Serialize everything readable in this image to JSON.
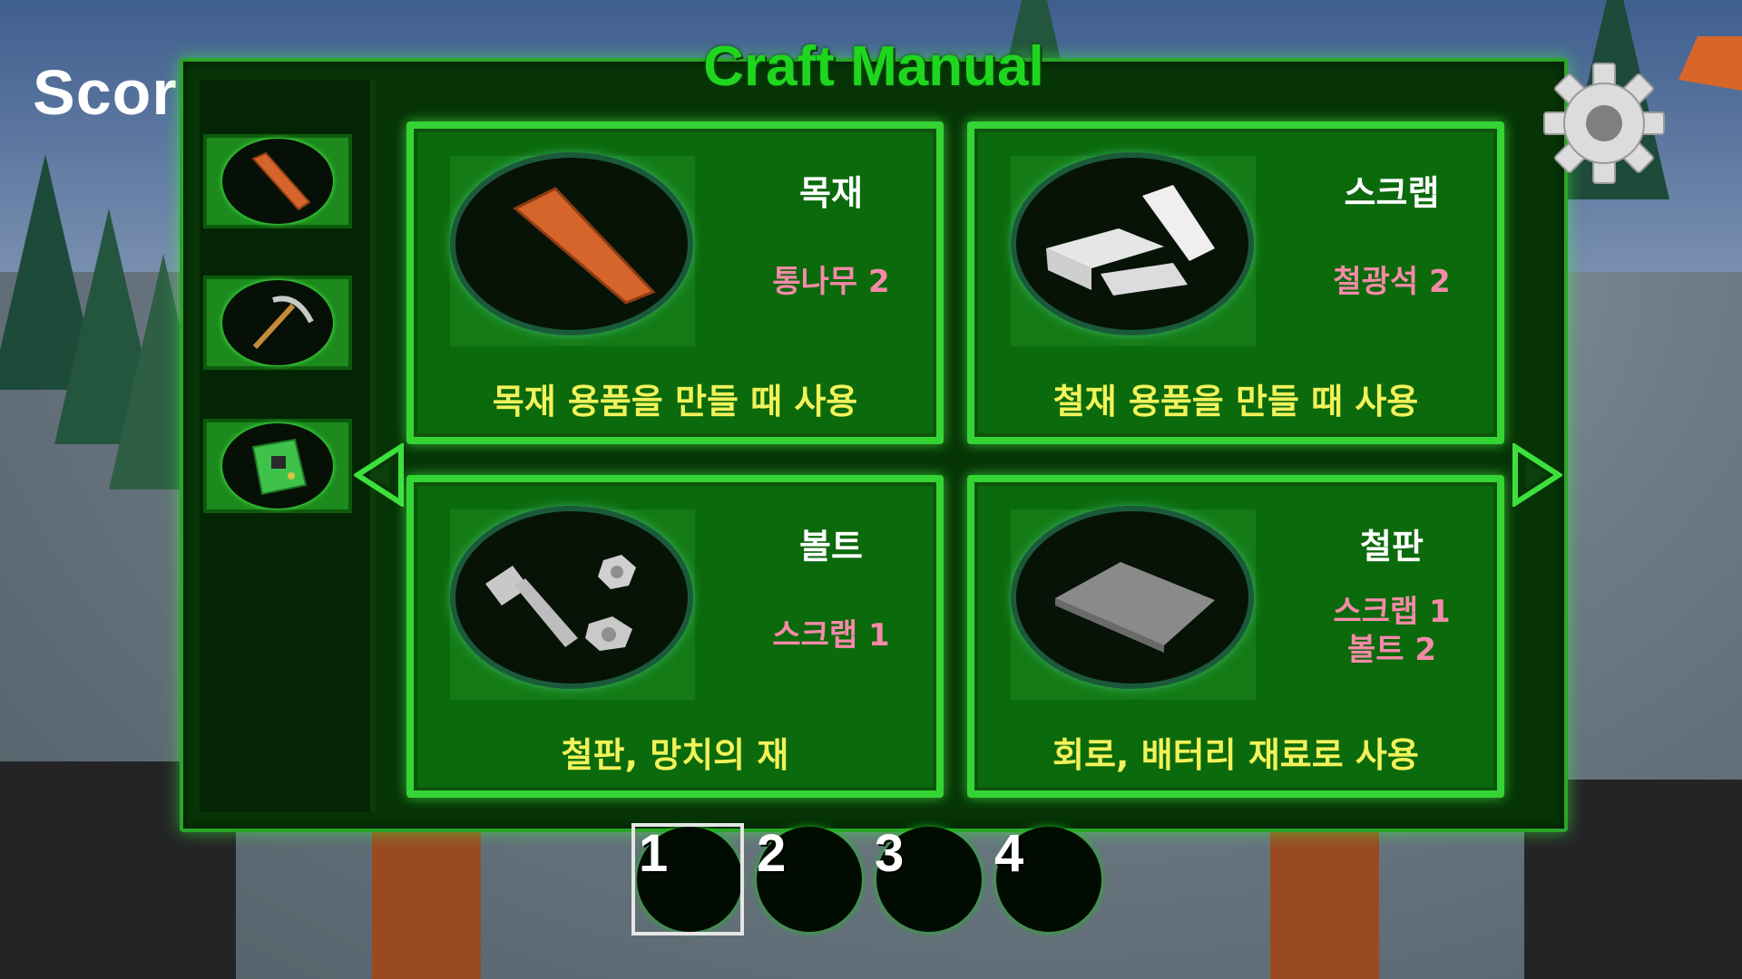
{
  "hud": {
    "score_label": "Scor"
  },
  "manual": {
    "title": "Craft Manual",
    "categories": [
      {
        "icon": "wood-plank-icon"
      },
      {
        "icon": "pickaxe-icon"
      },
      {
        "icon": "circuit-board-icon"
      }
    ],
    "items": [
      {
        "name": "목재",
        "recipe": [
          "통나무 2"
        ],
        "desc": "목재 용품을 만들 때 사용",
        "icon": "wood-plank-icon"
      },
      {
        "name": "스크랩",
        "recipe": [
          "철광석 2"
        ],
        "desc": "철재 용품을 만들 때 사용",
        "icon": "scrap-icon"
      },
      {
        "name": "볼트",
        "recipe": [
          "스크랩 1"
        ],
        "desc": "철판, 망치의 재",
        "icon": "bolt-icon"
      },
      {
        "name": "철판",
        "recipe": [
          "스크랩 1",
          "볼트 2"
        ],
        "desc": "회로, 배터리 재료로 사용",
        "icon": "iron-plate-icon"
      }
    ]
  },
  "hotbar": {
    "slots": [
      "1",
      "2",
      "3",
      "4"
    ],
    "selected": "1"
  },
  "colors": {
    "panel_bg": "#063406",
    "card_bg": "#0b6a0b",
    "border_green": "#35d435",
    "title_green": "#1fd61f",
    "recipe_pink": "#f58aa8",
    "desc_yellow": "#f2f25a"
  }
}
